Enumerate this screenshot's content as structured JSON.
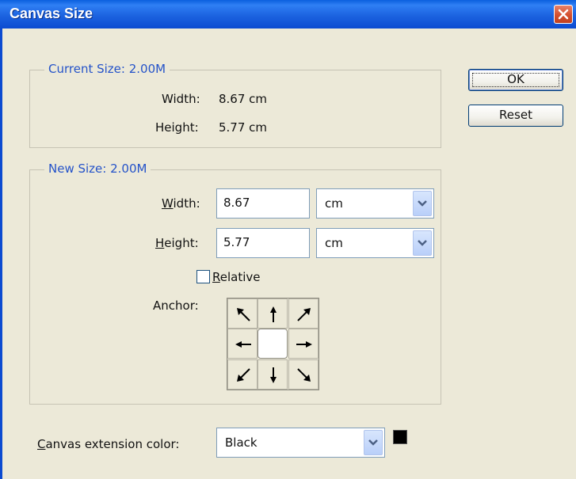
{
  "window": {
    "title": "Canvas Size"
  },
  "current_size": {
    "title": "Current Size: 2.00M",
    "width_label": "Width:",
    "width_value": "8.67 cm",
    "height_label": "Height:",
    "height_value": "5.77 cm"
  },
  "new_size": {
    "title": "New Size: 2.00M",
    "width_label_mnemonic": "W",
    "width_label_rest": "idth:",
    "width_value": "8.67",
    "width_unit": "cm",
    "height_label_mnemonic": "H",
    "height_label_rest": "eight:",
    "height_value": "5.77",
    "height_unit": "cm",
    "relative_label_mnemonic": "R",
    "relative_label_rest": "elative",
    "relative_checked": false,
    "anchor_label": "Anchor:",
    "anchor_selected": "center"
  },
  "buttons": {
    "ok": "OK",
    "reset": "Reset"
  },
  "extension": {
    "label_mnemonic": "C",
    "label_rest": "anvas extension color:",
    "value": "Black",
    "swatch_color": "#000000"
  },
  "colors": {
    "titlebar": "#0c4bd1",
    "group_title": "#2553c9",
    "dialog_bg": "#ece9d8"
  }
}
